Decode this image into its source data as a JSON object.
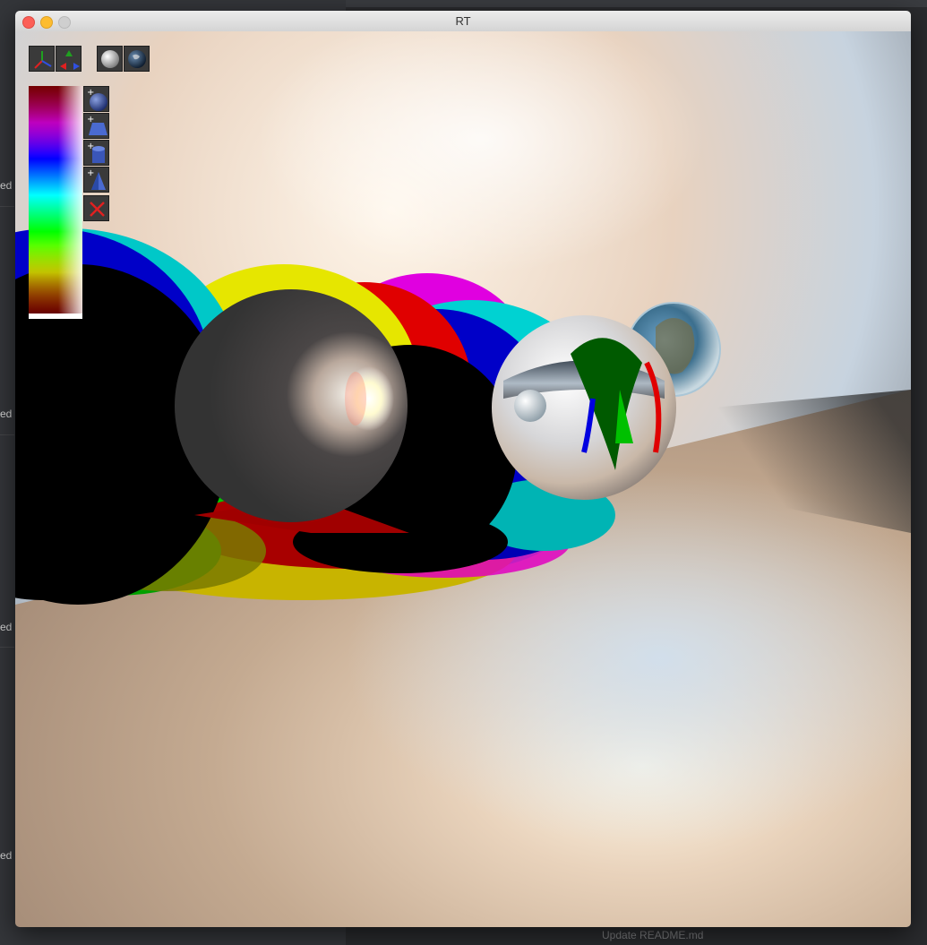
{
  "window": {
    "title": "RT",
    "traffic_lights": [
      "close",
      "minimize",
      "zoom"
    ]
  },
  "background_app": {
    "left_fragments": [
      "ed",
      "ed",
      "ed",
      "ed"
    ],
    "footer_text": "Update README.md"
  },
  "toolbar": {
    "view_buttons": [
      {
        "name": "axes-view-icon"
      },
      {
        "name": "axes-rotate-icon"
      }
    ],
    "texture_buttons": [
      {
        "name": "plain-sphere-icon"
      },
      {
        "name": "earth-texture-icon"
      }
    ],
    "add_buttons": [
      {
        "name": "add-sphere-icon"
      },
      {
        "name": "add-plane-icon"
      },
      {
        "name": "add-cylinder-icon"
      },
      {
        "name": "add-cone-icon"
      }
    ],
    "delete_button": {
      "name": "delete-object-icon",
      "color": "#e02020"
    }
  },
  "color_palette": {
    "hues": [
      "#ff0000",
      "#ff00ff",
      "#0000ff",
      "#00ffff",
      "#00ff00",
      "#ffff00",
      "#ff0000"
    ]
  },
  "scene": {
    "shadow_colors": [
      "#00c8c8",
      "#0000c8",
      "#00c800",
      "#e0e000",
      "#e00000",
      "#ff00ff"
    ],
    "floor_color": "#c9a88c",
    "sky_color": "#f3e4d2"
  }
}
